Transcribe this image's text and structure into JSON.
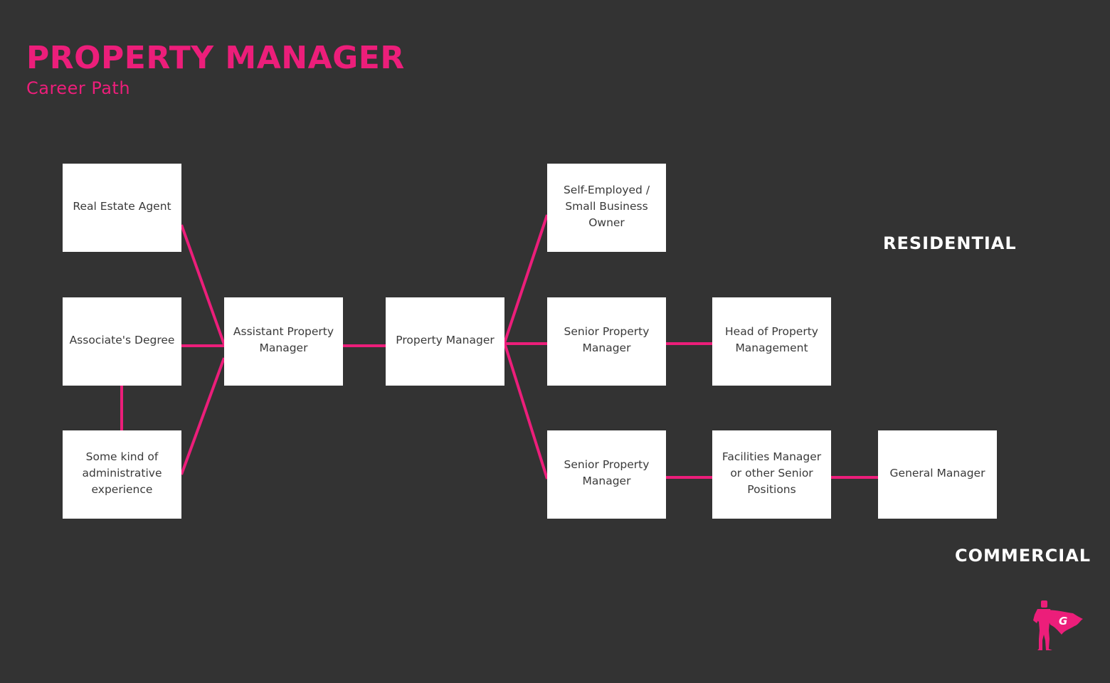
{
  "header": {
    "title": "PROPERTY MANAGER",
    "subtitle": "Career Path"
  },
  "colors": {
    "background": "#333333",
    "accent": "#ec1e7a",
    "box": "#ffffff",
    "box_text": "#3a3a3a",
    "section_label": "#ffffff"
  },
  "sections": {
    "residential": "RESIDENTIAL",
    "commercial": "COMMERCIAL"
  },
  "nodes": {
    "real_estate_agent": "Real Estate Agent",
    "associates_degree": "Associate's Degree",
    "admin_experience": "Some kind of administrative experience",
    "assistant_pm": "Assistant Property Manager",
    "property_manager": "Property Manager",
    "self_employed": "Self-Employed / Small Business Owner",
    "senior_pm_residential": "Senior Property Manager",
    "head_of_pm": "Head of Property Management",
    "senior_pm_commercial": "Senior Property Manager",
    "facilities_manager": "Facilities Manager or other Senior Positions",
    "general_manager": "General Manager"
  },
  "edges": [
    [
      "real_estate_agent",
      "assistant_pm"
    ],
    [
      "associates_degree",
      "assistant_pm"
    ],
    [
      "admin_experience",
      "assistant_pm"
    ],
    [
      "associates_degree",
      "admin_experience"
    ],
    [
      "assistant_pm",
      "property_manager"
    ],
    [
      "property_manager",
      "self_employed"
    ],
    [
      "property_manager",
      "senior_pm_residential"
    ],
    [
      "property_manager",
      "senior_pm_commercial"
    ],
    [
      "senior_pm_residential",
      "head_of_pm"
    ],
    [
      "senior_pm_commercial",
      "facilities_manager"
    ],
    [
      "facilities_manager",
      "general_manager"
    ]
  ],
  "logo": {
    "icon": "superhero-logo-icon",
    "letter": "G"
  }
}
